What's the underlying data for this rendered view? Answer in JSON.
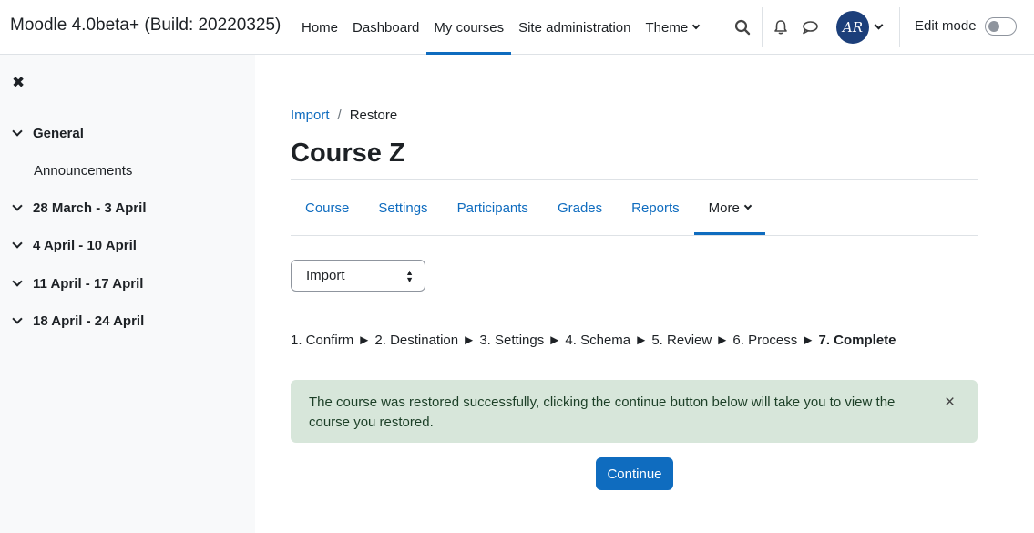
{
  "header": {
    "site_name": "Moodle 4.0beta+ (Build: 20220325)",
    "nav": [
      {
        "label": "Home"
      },
      {
        "label": "Dashboard"
      },
      {
        "label": "My courses",
        "active": true
      },
      {
        "label": "Site administration"
      },
      {
        "label": "Theme",
        "has_dropdown": true
      }
    ],
    "avatar_initials": "AR",
    "edit_mode_label": "Edit mode",
    "edit_mode_on": false
  },
  "drawer": {
    "sections": [
      {
        "label": "General",
        "items": [
          "Announcements"
        ]
      },
      {
        "label": "28 March - 3 April"
      },
      {
        "label": "4 April - 10 April"
      },
      {
        "label": "11 April - 17 April"
      },
      {
        "label": "18 April - 24 April"
      }
    ]
  },
  "main": {
    "breadcrumb": {
      "parent": "Import",
      "separator": "/",
      "current": "Restore"
    },
    "title": "Course Z",
    "tabs": [
      "Course",
      "Settings",
      "Participants",
      "Grades",
      "Reports",
      "More"
    ],
    "select_value": "Import",
    "steps": [
      "1. Confirm",
      "2. Destination",
      "3. Settings",
      "4. Schema",
      "5. Review",
      "6. Process"
    ],
    "current_step": "7. Complete",
    "step_separator": "►",
    "alert_message": "The course was restored successfully, clicking the continue button below will take you to view the course you restored.",
    "continue_label": "Continue"
  },
  "colors": {
    "accent": "#0f6cbf",
    "alert_bg": "#d7e6da",
    "drawer_bg": "#f8f9fa",
    "avatar_bg": "#1c3f7a"
  }
}
